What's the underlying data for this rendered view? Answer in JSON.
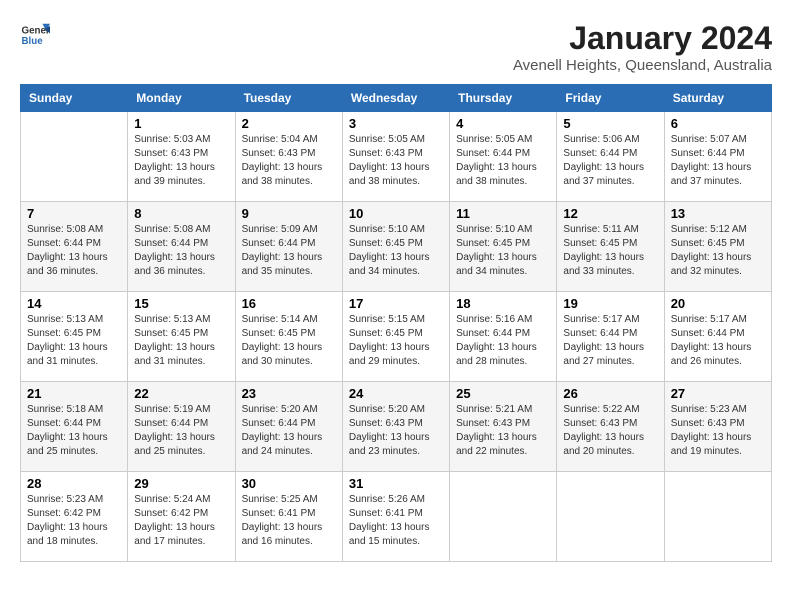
{
  "header": {
    "logo": {
      "general": "General",
      "blue": "Blue"
    },
    "title": "January 2024",
    "location": "Avenell Heights, Queensland, Australia"
  },
  "calendar": {
    "headers": [
      "Sunday",
      "Monday",
      "Tuesday",
      "Wednesday",
      "Thursday",
      "Friday",
      "Saturday"
    ],
    "weeks": [
      [
        {
          "day": "",
          "info": ""
        },
        {
          "day": "1",
          "info": "Sunrise: 5:03 AM\nSunset: 6:43 PM\nDaylight: 13 hours\nand 39 minutes."
        },
        {
          "day": "2",
          "info": "Sunrise: 5:04 AM\nSunset: 6:43 PM\nDaylight: 13 hours\nand 38 minutes."
        },
        {
          "day": "3",
          "info": "Sunrise: 5:05 AM\nSunset: 6:43 PM\nDaylight: 13 hours\nand 38 minutes."
        },
        {
          "day": "4",
          "info": "Sunrise: 5:05 AM\nSunset: 6:44 PM\nDaylight: 13 hours\nand 38 minutes."
        },
        {
          "day": "5",
          "info": "Sunrise: 5:06 AM\nSunset: 6:44 PM\nDaylight: 13 hours\nand 37 minutes."
        },
        {
          "day": "6",
          "info": "Sunrise: 5:07 AM\nSunset: 6:44 PM\nDaylight: 13 hours\nand 37 minutes."
        }
      ],
      [
        {
          "day": "7",
          "info": "Sunrise: 5:08 AM\nSunset: 6:44 PM\nDaylight: 13 hours\nand 36 minutes."
        },
        {
          "day": "8",
          "info": "Sunrise: 5:08 AM\nSunset: 6:44 PM\nDaylight: 13 hours\nand 36 minutes."
        },
        {
          "day": "9",
          "info": "Sunrise: 5:09 AM\nSunset: 6:44 PM\nDaylight: 13 hours\nand 35 minutes."
        },
        {
          "day": "10",
          "info": "Sunrise: 5:10 AM\nSunset: 6:45 PM\nDaylight: 13 hours\nand 34 minutes."
        },
        {
          "day": "11",
          "info": "Sunrise: 5:10 AM\nSunset: 6:45 PM\nDaylight: 13 hours\nand 34 minutes."
        },
        {
          "day": "12",
          "info": "Sunrise: 5:11 AM\nSunset: 6:45 PM\nDaylight: 13 hours\nand 33 minutes."
        },
        {
          "day": "13",
          "info": "Sunrise: 5:12 AM\nSunset: 6:45 PM\nDaylight: 13 hours\nand 32 minutes."
        }
      ],
      [
        {
          "day": "14",
          "info": "Sunrise: 5:13 AM\nSunset: 6:45 PM\nDaylight: 13 hours\nand 31 minutes."
        },
        {
          "day": "15",
          "info": "Sunrise: 5:13 AM\nSunset: 6:45 PM\nDaylight: 13 hours\nand 31 minutes."
        },
        {
          "day": "16",
          "info": "Sunrise: 5:14 AM\nSunset: 6:45 PM\nDaylight: 13 hours\nand 30 minutes."
        },
        {
          "day": "17",
          "info": "Sunrise: 5:15 AM\nSunset: 6:45 PM\nDaylight: 13 hours\nand 29 minutes."
        },
        {
          "day": "18",
          "info": "Sunrise: 5:16 AM\nSunset: 6:44 PM\nDaylight: 13 hours\nand 28 minutes."
        },
        {
          "day": "19",
          "info": "Sunrise: 5:17 AM\nSunset: 6:44 PM\nDaylight: 13 hours\nand 27 minutes."
        },
        {
          "day": "20",
          "info": "Sunrise: 5:17 AM\nSunset: 6:44 PM\nDaylight: 13 hours\nand 26 minutes."
        }
      ],
      [
        {
          "day": "21",
          "info": "Sunrise: 5:18 AM\nSunset: 6:44 PM\nDaylight: 13 hours\nand 25 minutes."
        },
        {
          "day": "22",
          "info": "Sunrise: 5:19 AM\nSunset: 6:44 PM\nDaylight: 13 hours\nand 25 minutes."
        },
        {
          "day": "23",
          "info": "Sunrise: 5:20 AM\nSunset: 6:44 PM\nDaylight: 13 hours\nand 24 minutes."
        },
        {
          "day": "24",
          "info": "Sunrise: 5:20 AM\nSunset: 6:43 PM\nDaylight: 13 hours\nand 23 minutes."
        },
        {
          "day": "25",
          "info": "Sunrise: 5:21 AM\nSunset: 6:43 PM\nDaylight: 13 hours\nand 22 minutes."
        },
        {
          "day": "26",
          "info": "Sunrise: 5:22 AM\nSunset: 6:43 PM\nDaylight: 13 hours\nand 20 minutes."
        },
        {
          "day": "27",
          "info": "Sunrise: 5:23 AM\nSunset: 6:43 PM\nDaylight: 13 hours\nand 19 minutes."
        }
      ],
      [
        {
          "day": "28",
          "info": "Sunrise: 5:23 AM\nSunset: 6:42 PM\nDaylight: 13 hours\nand 18 minutes."
        },
        {
          "day": "29",
          "info": "Sunrise: 5:24 AM\nSunset: 6:42 PM\nDaylight: 13 hours\nand 17 minutes."
        },
        {
          "day": "30",
          "info": "Sunrise: 5:25 AM\nSunset: 6:41 PM\nDaylight: 13 hours\nand 16 minutes."
        },
        {
          "day": "31",
          "info": "Sunrise: 5:26 AM\nSunset: 6:41 PM\nDaylight: 13 hours\nand 15 minutes."
        },
        {
          "day": "",
          "info": ""
        },
        {
          "day": "",
          "info": ""
        },
        {
          "day": "",
          "info": ""
        }
      ]
    ]
  }
}
